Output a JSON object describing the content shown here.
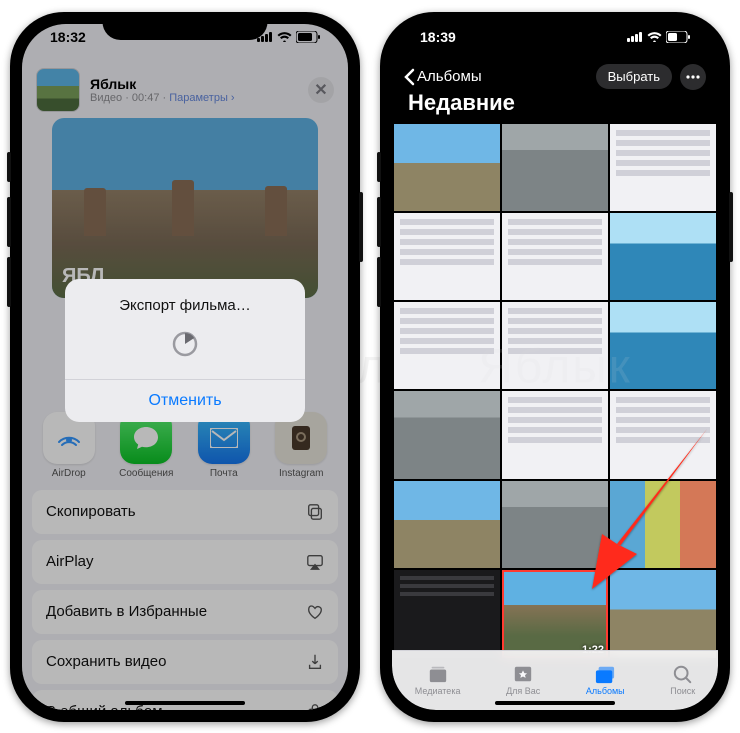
{
  "left": {
    "time": "18:32",
    "item": {
      "title": "Яблык",
      "type": "Видео",
      "duration": "00:47",
      "params": "Параметры",
      "badge": "ЯБЛ"
    },
    "modal": {
      "title": "Экспорт фильма…",
      "cancel": "Отменить"
    },
    "apps": {
      "airdrop": "AirDrop",
      "messages": "Сообщения",
      "mail": "Почта",
      "instagram": "Instagram"
    },
    "actions": {
      "copy": "Скопировать",
      "airplay": "AirPlay",
      "favorite": "Добавить в Избранные",
      "save": "Сохранить видео",
      "shared": "В общий альбом"
    }
  },
  "right": {
    "time": "18:39",
    "back": "Альбомы",
    "select": "Выбрать",
    "title": "Недавние",
    "video_duration": "1:22",
    "tabs": {
      "library": "Медиатека",
      "foryou": "Для Вас",
      "albums": "Альбомы",
      "search": "Поиск"
    }
  },
  "watermark": "Яблык"
}
